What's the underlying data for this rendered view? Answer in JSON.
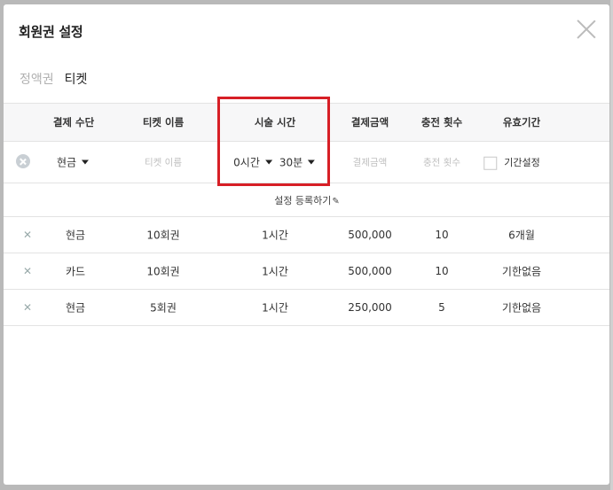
{
  "modal": {
    "title": "회원권 설정"
  },
  "tabs": [
    {
      "label": "정액권",
      "active": false
    },
    {
      "label": "티켓",
      "active": true
    }
  ],
  "table": {
    "headers": [
      "결제 수단",
      "티켓 이름",
      "시술 시간",
      "결제금액",
      "충전 횟수",
      "유효기간"
    ],
    "input_row": {
      "payment_method": "현금",
      "ticket_name_placeholder": "티켓 이름",
      "hours": "0시간",
      "minutes": "30분",
      "amount_placeholder": "결제금액",
      "count_placeholder": "충전 횟수",
      "validity_checkbox_label": "기간설정"
    },
    "register_link": "설정 등록하기",
    "rows": [
      {
        "payment": "현금",
        "ticket": "10회권",
        "duration": "1시간",
        "amount": "500,000",
        "count": "10",
        "validity": "6개월"
      },
      {
        "payment": "카드",
        "ticket": "10회권",
        "duration": "1시간",
        "amount": "500,000",
        "count": "10",
        "validity": "기한없음"
      },
      {
        "payment": "현금",
        "ticket": "5회권",
        "duration": "1시간",
        "amount": "250,000",
        "count": "5",
        "validity": "기한없음"
      }
    ]
  },
  "icons": {
    "close": "close-icon",
    "remove_row": "remove-circle-icon",
    "delete_row": "delete-x-icon",
    "dropdown": "caret-down-icon",
    "edit": "pencil-icon"
  },
  "colors": {
    "highlight": "#d71f26",
    "header_bg": "#f7f7f8",
    "inactive_tab": "#b0b0b0"
  }
}
